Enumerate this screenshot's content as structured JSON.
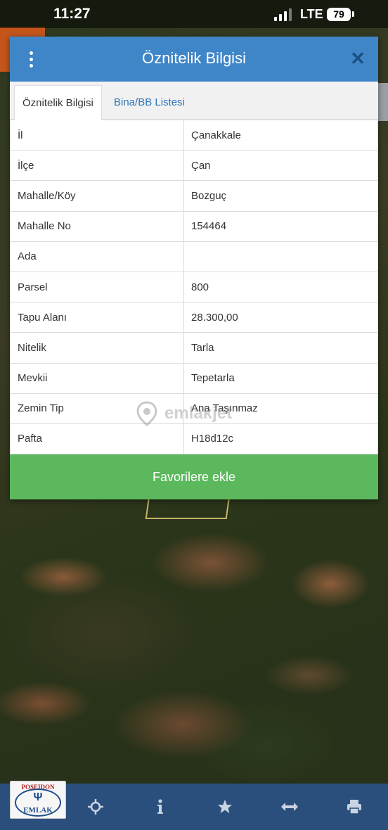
{
  "status_bar": {
    "time": "11:27",
    "network": "LTE",
    "battery": "79"
  },
  "dialog": {
    "title": "Öznitelik Bilgisi",
    "tabs": [
      {
        "label": "Öznitelik Bilgisi",
        "active": true
      },
      {
        "label": "Bina/BB Listesi",
        "active": false
      }
    ],
    "rows": [
      {
        "key": "İl",
        "value": "Çanakkale"
      },
      {
        "key": "İlçe",
        "value": "Çan"
      },
      {
        "key": "Mahalle/Köy",
        "value": "Bozguç"
      },
      {
        "key": "Mahalle No",
        "value": "154464"
      },
      {
        "key": "Ada",
        "value": ""
      },
      {
        "key": "Parsel",
        "value": "800"
      },
      {
        "key": "Tapu Alanı",
        "value": "28.300,00"
      },
      {
        "key": "Nitelik",
        "value": "Tarla"
      },
      {
        "key": "Mevkii",
        "value": "Tepetarla"
      },
      {
        "key": "Zemin Tip",
        "value": "Ana Taşınmaz"
      },
      {
        "key": "Pafta",
        "value": "H18d12c"
      }
    ],
    "favorite_button": "Favorilere ekle"
  },
  "watermark": "emlakjet",
  "logo": {
    "top_text": "POSEIDON",
    "bottom_text": "EMLAK"
  },
  "bottom_nav": [
    {
      "icon": "crosshair-icon"
    },
    {
      "icon": "info-icon"
    },
    {
      "icon": "star-icon"
    },
    {
      "icon": "measure-arrows-icon"
    },
    {
      "icon": "print-icon"
    }
  ],
  "colors": {
    "header": "#3f86c9",
    "close": "#1d4f7e",
    "tab_link": "#2f76b8",
    "favorite_button": "#5cb85c",
    "bottom_bar": "#2b4f7c"
  }
}
